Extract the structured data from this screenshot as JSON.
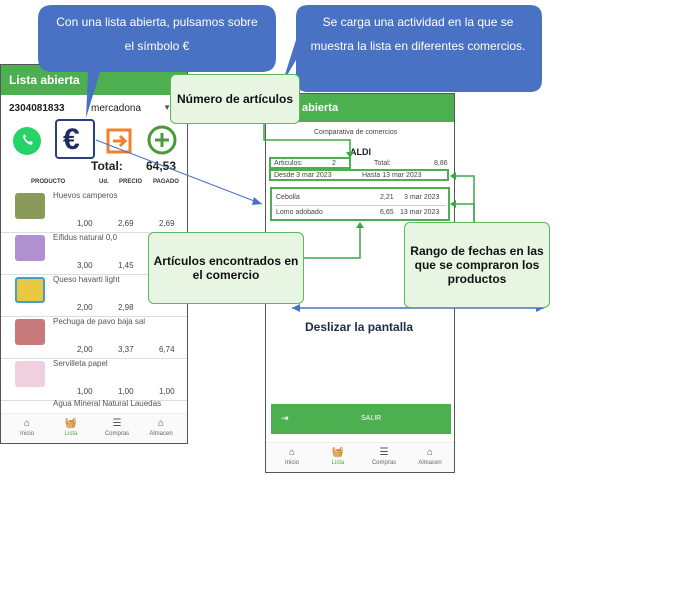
{
  "callouts": {
    "blue_left": "Con una lista abierta, pulsamos sobre el símbolo €",
    "blue_right": "Se carga una actividad en la que se muestra la lista en diferentes comercios.",
    "green_articulos": "Número de artículos",
    "green_encontrados": "Artículos encontrados en el comercio",
    "green_fechas": "Rango de fechas en las que se compraron los productos",
    "swipe": "Deslizar la pantalla"
  },
  "left_phone": {
    "title": "Lista abierta",
    "ticket": "2304081833",
    "store": "mercadona",
    "total_label": "Total:",
    "total_value": "64,53",
    "columns": {
      "product": "PRODUCTO",
      "ud": "Ud.",
      "precio": "PRECIO",
      "pagado": "PAGADO"
    },
    "items": [
      {
        "name": "Huevos camperos",
        "ud": "1,00",
        "precio": "2,69",
        "pagado": "2,69"
      },
      {
        "name": "Eifidus natural 0,0",
        "ud": "3,00",
        "precio": "1,45",
        "pagado": ""
      },
      {
        "name": "Queso havarti light",
        "ud": "2,00",
        "precio": "2,98",
        "pagado": ""
      },
      {
        "name": "Pechuga de pavo baja sal",
        "ud": "2,00",
        "precio": "3,37",
        "pagado": "6,74"
      },
      {
        "name": "Servilleta papel",
        "ud": "1,00",
        "precio": "1,00",
        "pagado": "1,00"
      },
      {
        "name": "Agua Mineral Natural Lauedas",
        "ud": "",
        "precio": "",
        "pagado": ""
      }
    ],
    "nav": [
      "Inicio",
      "Lista",
      "Compras",
      "Almacen"
    ],
    "icons": {
      "whatsapp": "whatsapp-icon",
      "euro": "euro-icon",
      "export": "export-icon",
      "add": "add-icon"
    },
    "euro_symbol": "€"
  },
  "right_phone": {
    "title": "abierta",
    "heading": "Comparativa de comercios",
    "store": "ALDI",
    "articulos_label": "Articulos:",
    "articulos_value": "2",
    "total_label": "Total:",
    "total_value": "8,86",
    "desde": "Desde  3 mar 2023",
    "hasta": "Hasta  13 mar 2023",
    "rows": [
      {
        "name": "Cebolla",
        "price": "2,21",
        "date": "3 mar 2023"
      },
      {
        "name": "Lomo adobado",
        "price": "6,65",
        "date": "13 mar 2023"
      }
    ],
    "salir": "SALIR",
    "nav": [
      "Inicio",
      "Lista",
      "Compras",
      "Almacen"
    ]
  },
  "colors": {
    "green": "#4caf50",
    "blue": "#4a72c4",
    "callout_green_bg": "#e8f5e3"
  }
}
